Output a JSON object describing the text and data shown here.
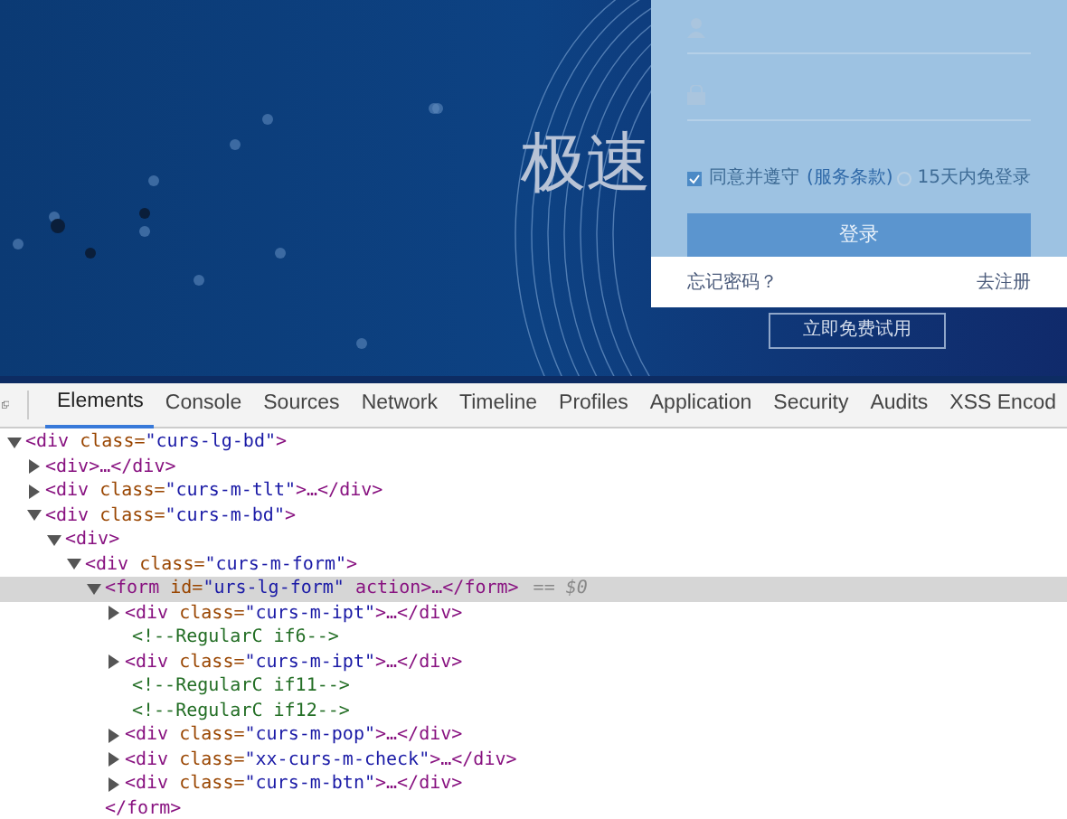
{
  "hero": {
    "title": "极速",
    "trial_button": "立即免费试用"
  },
  "login": {
    "remember": {
      "label": "同意并遵守",
      "link": "(服务条款)",
      "checked": true
    },
    "auto_login": {
      "label": "15天内免登录",
      "checked": false
    },
    "submit": "登录",
    "forgot": "忘记密码？",
    "register": "去注册"
  },
  "devtools": {
    "tabs": [
      {
        "label": "Elements",
        "selected": true
      },
      {
        "label": "Console",
        "selected": false
      },
      {
        "label": "Sources",
        "selected": false
      },
      {
        "label": "Network",
        "selected": false
      },
      {
        "label": "Timeline",
        "selected": false
      },
      {
        "label": "Profiles",
        "selected": false
      },
      {
        "label": "Application",
        "selected": false
      },
      {
        "label": "Security",
        "selected": false
      },
      {
        "label": "Audits",
        "selected": false
      },
      {
        "label": "XSS Encod",
        "selected": false
      }
    ],
    "tree": [
      {
        "kind": "element",
        "text": "<div class=\"curs-lg-bd\">",
        "expanded": true,
        "selected": false,
        "children": [
          {
            "kind": "element",
            "text": "<div>…</div>",
            "expanded": false,
            "selected": false
          },
          {
            "kind": "element",
            "text": "<div class=\"curs-m-tlt\">…</div>",
            "expanded": false,
            "selected": false
          },
          {
            "kind": "element",
            "text": "<div class=\"curs-m-bd\">",
            "expanded": true,
            "selected": false,
            "children": [
              {
                "kind": "element",
                "text": "<div>",
                "expanded": true,
                "selected": false,
                "children": [
                  {
                    "kind": "element",
                    "text": "<div class=\"curs-m-form\">",
                    "expanded": true,
                    "selected": false,
                    "children": [
                      {
                        "kind": "element",
                        "text": "<form id=\"urs-lg-form\" action>…</form>",
                        "suffix": "== $0",
                        "expanded": true,
                        "selected": true,
                        "children": [
                          {
                            "kind": "element",
                            "text": "<div class=\"curs-m-ipt\">…</div>",
                            "expanded": false,
                            "selected": false
                          },
                          {
                            "kind": "comment",
                            "text": "<!--RegularC if6-->",
                            "selected": false
                          },
                          {
                            "kind": "element",
                            "text": "<div class=\"curs-m-ipt\">…</div>",
                            "expanded": false,
                            "selected": false
                          },
                          {
                            "kind": "comment",
                            "text": "<!--RegularC if11-->",
                            "selected": false
                          },
                          {
                            "kind": "comment",
                            "text": "<!--RegularC if12-->",
                            "selected": false
                          },
                          {
                            "kind": "element",
                            "text": "<div class=\"curs-m-pop\">…</div>",
                            "expanded": false,
                            "selected": false
                          },
                          {
                            "kind": "element",
                            "text": "<div class=\"xx-curs-m-check\">…</div>",
                            "expanded": false,
                            "selected": false
                          },
                          {
                            "kind": "element",
                            "text": "<div class=\"curs-m-btn\">…</div>",
                            "expanded": false,
                            "selected": false
                          }
                        ]
                      },
                      {
                        "kind": "close",
                        "text": "</form>",
                        "selected": false
                      }
                    ]
                  }
                ]
              }
            ]
          }
        ]
      }
    ]
  }
}
